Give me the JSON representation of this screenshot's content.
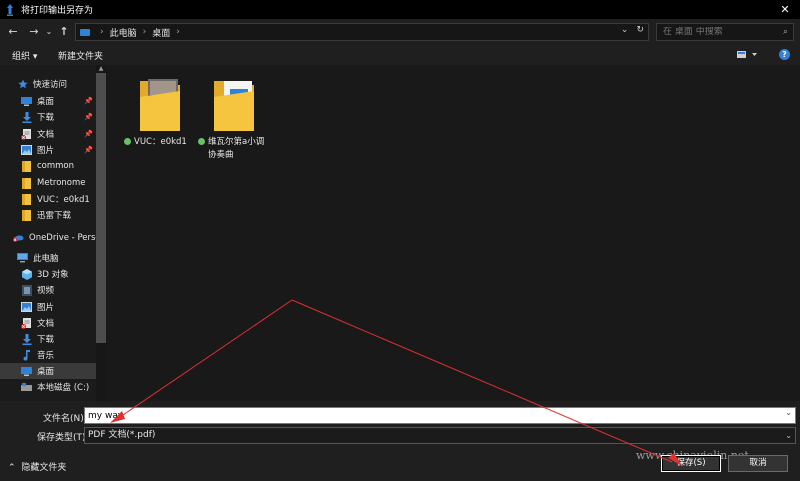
{
  "window": {
    "title": "将打印输出另存为"
  },
  "nav": {
    "breadcrumbs": [
      "此电脑",
      "桌面"
    ],
    "search_placeholder": "在 桌面 中搜索"
  },
  "toolbar": {
    "organize": "组织 ▾",
    "new_folder": "新建文件夹"
  },
  "sidebar": {
    "items": [
      {
        "label": "快速访问",
        "icon": "star-icon"
      },
      {
        "label": "桌面",
        "icon": "desktop-icon"
      },
      {
        "label": "下载",
        "icon": "download-icon"
      },
      {
        "label": "文档",
        "icon": "document-icon"
      },
      {
        "label": "图片",
        "icon": "pictures-icon"
      },
      {
        "label": "common",
        "icon": "folder-icon"
      },
      {
        "label": "Metronome",
        "icon": "folder-icon"
      },
      {
        "label": "VUC：e0kd1",
        "icon": "folder-icon"
      },
      {
        "label": "迅雷下载",
        "icon": "folder-icon"
      },
      {
        "label": "OneDrive - Perso",
        "icon": "cloud-icon"
      },
      {
        "label": "此电脑",
        "icon": "computer-icon"
      },
      {
        "label": "3D 对象",
        "icon": "3d-objects-icon"
      },
      {
        "label": "视频",
        "icon": "video-icon"
      },
      {
        "label": "图片",
        "icon": "pictures-icon"
      },
      {
        "label": "文档",
        "icon": "document-icon"
      },
      {
        "label": "下载",
        "icon": "download-icon"
      },
      {
        "label": "音乐",
        "icon": "music-icon"
      },
      {
        "label": "桌面",
        "icon": "desktop-icon"
      },
      {
        "label": "本地磁盘 (C:)",
        "icon": "drive-icon"
      }
    ]
  },
  "files": [
    {
      "name": "VUC：e0kd1",
      "icon": "folder-icon"
    },
    {
      "name_line1": "维瓦尔第a小调",
      "name_line2": "协奏曲",
      "icon": "folder-icon"
    }
  ],
  "form": {
    "filename_label": "文件名(N):",
    "filename_value": "my way",
    "filetype_label": "保存类型(T):",
    "filetype_value": "PDF 文档(*.pdf)"
  },
  "footer": {
    "hide_folders": "隐藏文件夹",
    "save": "保存(S)",
    "cancel": "取消"
  },
  "watermark": "www.chinaviolin.net",
  "colors": {
    "accent": "#2f82d8",
    "arrow": "#e03030",
    "folder": "#f0c040"
  }
}
